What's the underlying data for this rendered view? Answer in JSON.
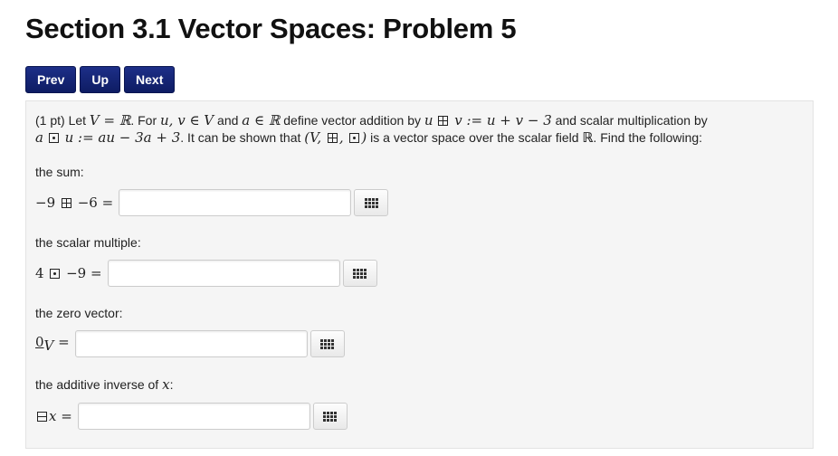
{
  "page": {
    "title": "Section 3.1 Vector Spaces: Problem 5"
  },
  "nav": {
    "prev": "Prev",
    "up": "Up",
    "next": "Next"
  },
  "problem": {
    "points": "(1 pt) Let",
    "intro_1": "V = ℝ",
    "intro_2": ". For ",
    "intro_3": "u, v ∈ V",
    "intro_4": " and ",
    "intro_5": "a ∈ ℝ",
    "intro_6": " define vector addition by ",
    "intro_7": "u",
    "intro_8": " v := u + v − 3",
    "intro_9": " and scalar multiplication by",
    "intro_10": "a",
    "intro_11": " u := au − 3a + 3",
    "intro_12": ". It can be shown that ",
    "intro_13": "(V, ",
    "intro_14": ", ",
    "intro_15": ")",
    "intro_16": " is a vector space over the scalar field ",
    "intro_17": "ℝ",
    "intro_18": ". Find the following:",
    "q1_label": "the sum:",
    "q1_lhs_a": "−9",
    "q1_lhs_b": "−6 =",
    "q2_label": "the scalar multiple:",
    "q2_lhs_a": "4",
    "q2_lhs_b": "−9 =",
    "q3_label": "the zero vector:",
    "q3_lhs_a": "0",
    "q3_lhs_sub": "V",
    "q3_lhs_b": " =",
    "q4_label_a": "the additive inverse of ",
    "q4_label_b": "x",
    "q4_label_c": ":",
    "q4_lhs": "x ="
  },
  "answers": {
    "q1": "",
    "q2": "",
    "q3": "",
    "q4": ""
  },
  "icons": {
    "palette": "equation-palette-icon",
    "boxplus": "boxplus-operator",
    "boxdot": "boxdot-operator",
    "boxminus": "boxminus-operator"
  },
  "colors": {
    "nav_button": "#1d2f88",
    "panel_bg": "#f5f5f5"
  }
}
